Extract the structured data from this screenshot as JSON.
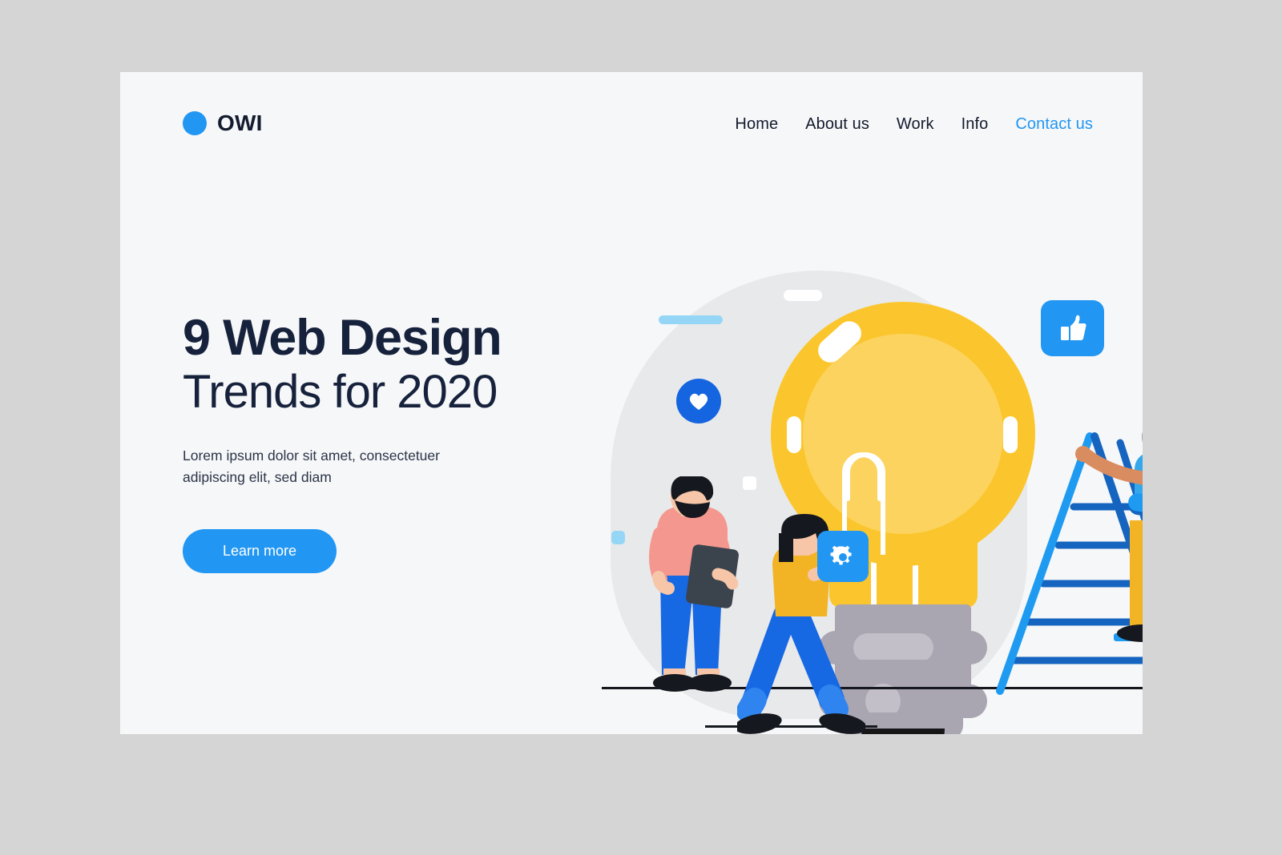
{
  "brand": {
    "name": "OWI",
    "logo_icon": "blue-circle-dot",
    "color": "#2196f3"
  },
  "nav": {
    "items": [
      {
        "label": "Home",
        "accent": false
      },
      {
        "label": "About us",
        "accent": false
      },
      {
        "label": "Work",
        "accent": false
      },
      {
        "label": "Info",
        "accent": false
      },
      {
        "label": "Contact us",
        "accent": true
      }
    ],
    "accent_color": "#2196f3"
  },
  "hero": {
    "headline_bold": "9 Web Design",
    "headline_light": "Trends for 2020",
    "subtext": "Lorem ipsum dolor sit amet, consectetuer adipiscing elit, sed diam",
    "cta_label": "Learn more",
    "text_color": "#16213c",
    "cta_color": "#2196f3"
  },
  "illustration": {
    "theme": "lightbulb-idea-teamwork",
    "badges": [
      {
        "icon": "heart-icon",
        "shape": "circle",
        "color": "#1565e0"
      },
      {
        "icon": "thumbs-up-icon",
        "shape": "rounded-rectangle",
        "color": "#2196f3"
      },
      {
        "icon": "gear-icon",
        "shape": "rounded-square",
        "color": "#2196f3"
      }
    ],
    "decorations": [
      {
        "name": "bar",
        "color": "#95d6f7"
      },
      {
        "name": "bar",
        "color": "#95d6f7"
      },
      {
        "name": "square",
        "color": "#95d6f7"
      },
      {
        "name": "square",
        "color": "#95d6f7"
      },
      {
        "name": "square",
        "color": "#ffffff"
      },
      {
        "name": "chat-dots",
        "color": "#f79191"
      }
    ],
    "characters": [
      {
        "name": "man-with-tablet",
        "shirt": "#f4978e",
        "pants": "#1668e3"
      },
      {
        "name": "woman-walking",
        "shirt": "#f2b424",
        "pants": "#1668e3"
      },
      {
        "name": "woman-on-ladder",
        "shirt": "#35a7eb",
        "pants": "#f2b424"
      }
    ],
    "bulb": {
      "glass": "#fbc62d",
      "glass_inner": "#fcd35e",
      "base": "#a9a5b1",
      "tip": "#161616"
    },
    "blob_color": "#e8e9ea"
  },
  "page": {
    "background": "#d5d5d5",
    "card_background": "#f6f7f8"
  }
}
